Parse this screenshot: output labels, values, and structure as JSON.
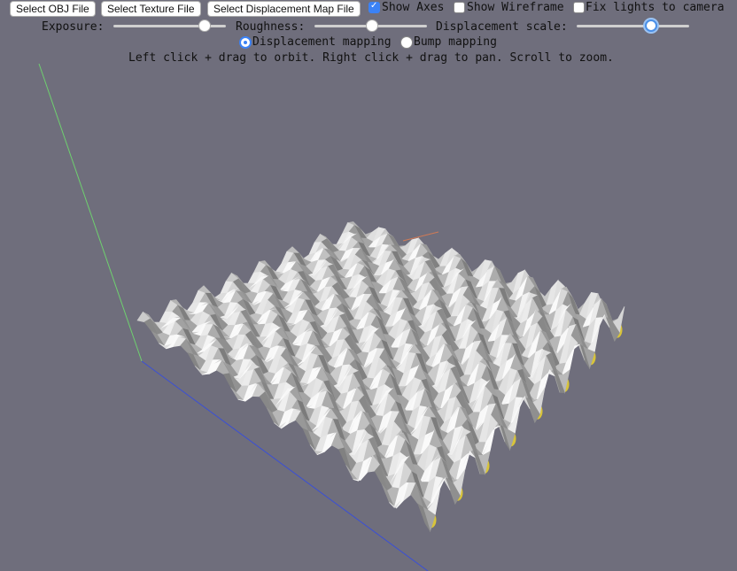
{
  "toolbar": {
    "select_obj": "Select OBJ File",
    "select_texture": "Select Texture File",
    "select_displacement": "Select Displacement Map File",
    "show_axes_label": "Show Axes",
    "show_axes_checked": true,
    "show_wireframe_label": "Show Wireframe",
    "show_wireframe_checked": false,
    "fix_lights_label": "Fix lights to camera",
    "fix_lights_checked": false
  },
  "sliders": {
    "exposure_label": "Exposure:",
    "exposure_value": 0.8,
    "roughness_label": "Roughness:",
    "roughness_value": 0.5,
    "displacement_label": "Displacement scale:",
    "displacement_value": 0.65
  },
  "mapping": {
    "displacement_label": "Displacement mapping",
    "bump_label": "Bump mapping",
    "selected": "displacement"
  },
  "instructions": "Left click + drag to orbit. Right click + drag to pan. Scroll to zoom.",
  "colors": {
    "background": "#6f6e7c",
    "x_axis": "#3a4fd6",
    "y_axis": "#6fd06f",
    "z_axis": "#d07a55",
    "surface": "#d8d8d8",
    "underside": "#d8c43a"
  }
}
